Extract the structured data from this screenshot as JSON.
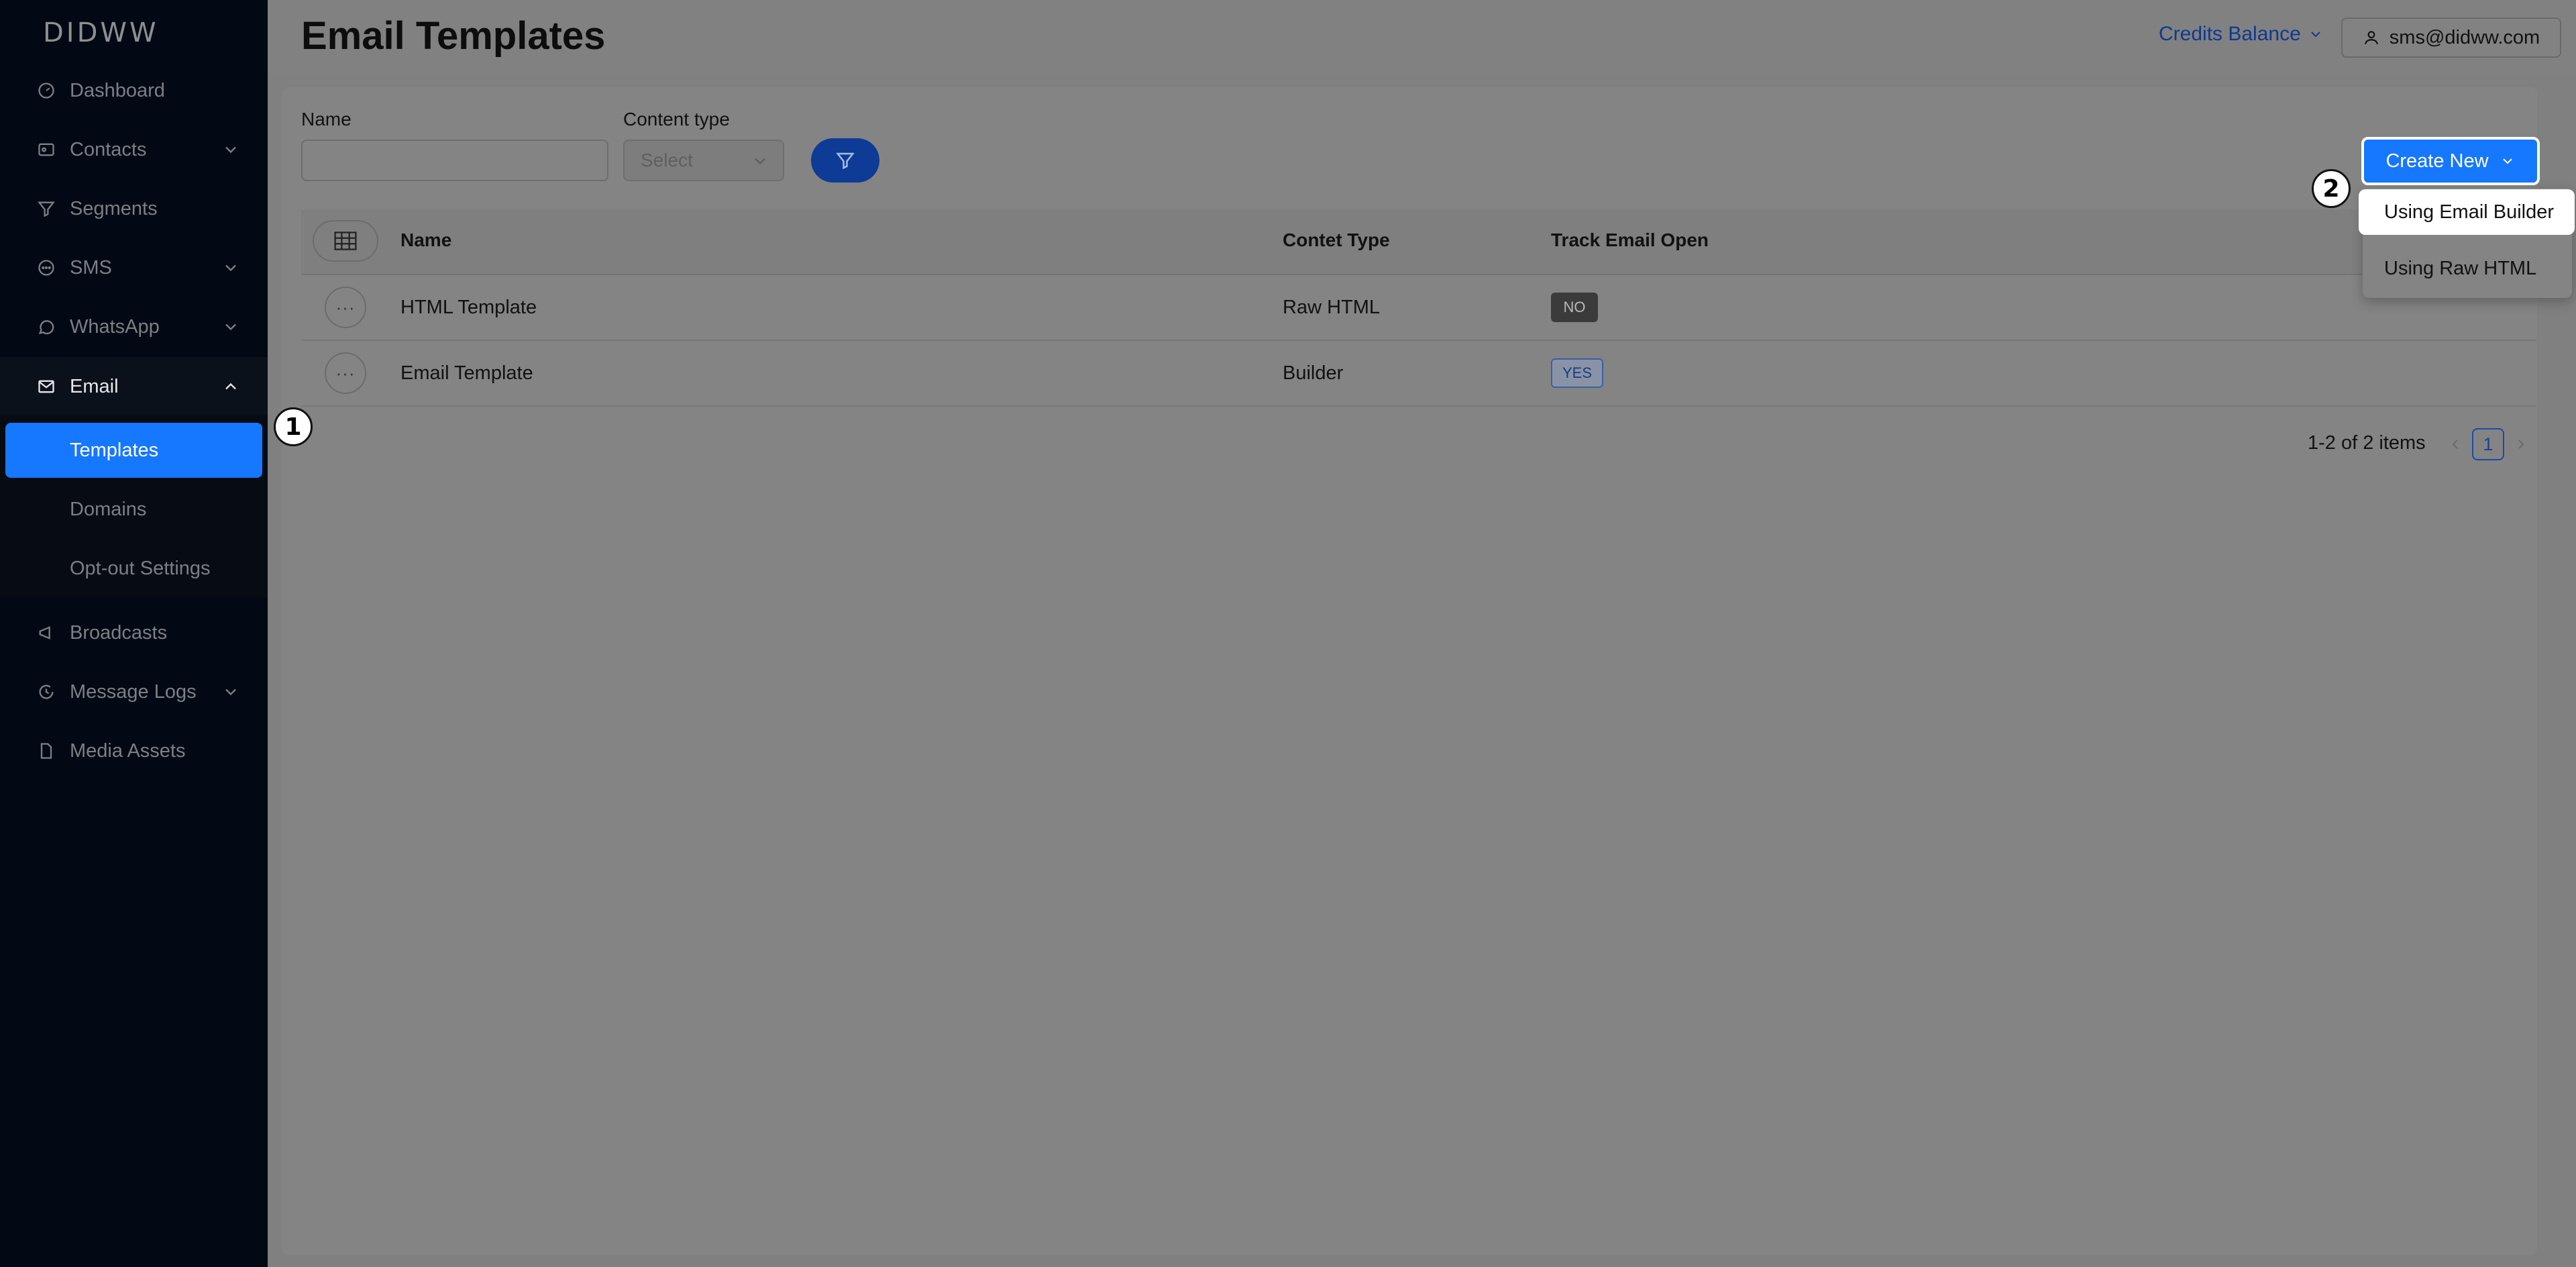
{
  "app": {
    "logo": "DIDWW"
  },
  "sidebar": {
    "items": [
      {
        "label": "Dashboard",
        "icon": "dashboard-icon"
      },
      {
        "label": "Contacts",
        "icon": "contacts-icon",
        "expandable": true
      },
      {
        "label": "Segments",
        "icon": "filter-icon"
      },
      {
        "label": "SMS",
        "icon": "sms-icon",
        "expandable": true
      },
      {
        "label": "WhatsApp",
        "icon": "whatsapp-icon",
        "expandable": true
      },
      {
        "label": "Email",
        "icon": "mail-icon",
        "expanded": true
      },
      {
        "label": "Broadcasts",
        "icon": "megaphone-icon"
      },
      {
        "label": "Message Logs",
        "icon": "history-icon",
        "expandable": true
      },
      {
        "label": "Media Assets",
        "icon": "file-icon"
      }
    ],
    "email_submenu": [
      "Templates",
      "Domains",
      "Opt-out Settings"
    ],
    "active_item": "Templates"
  },
  "header": {
    "title": "Email Templates",
    "credits_label": "Credits Balance",
    "user_email": "sms@didww.com"
  },
  "filters": {
    "name_label": "Name",
    "name_value": "",
    "content_type_label": "Content type",
    "content_type_placeholder": "Select"
  },
  "actions": {
    "create_label": "Create New",
    "dropdown": [
      "Using Email Builder",
      "Using Raw HTML"
    ]
  },
  "table": {
    "columns": [
      "Name",
      "Contet Type",
      "Track Email Open"
    ],
    "rows": [
      {
        "name": "HTML Template",
        "content_type": "Raw HTML",
        "track": "NO"
      },
      {
        "name": "Email Template",
        "content_type": "Builder",
        "track": "YES"
      }
    ]
  },
  "pagination": {
    "summary": "1-2 of 2 items",
    "current_page": "1"
  },
  "annotations": {
    "step1": "1",
    "step2": "2"
  },
  "colors": {
    "accent": "#1677ff",
    "sidebar_bg": "#020914",
    "overlay": "#808080"
  }
}
